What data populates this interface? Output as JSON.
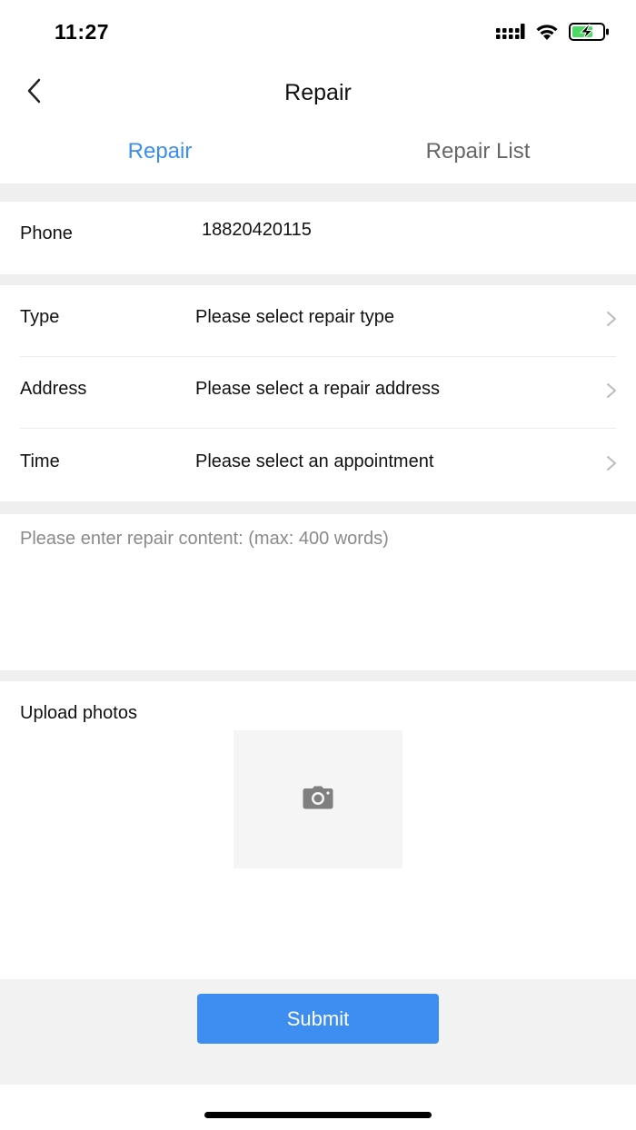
{
  "status_bar": {
    "time": "11:27"
  },
  "nav": {
    "title": "Repair"
  },
  "tabs": [
    {
      "label": "Repair",
      "active": true
    },
    {
      "label": "Repair List",
      "active": false
    }
  ],
  "form": {
    "phone": {
      "label": "Phone",
      "value": "18820420115"
    },
    "type": {
      "label": "Type",
      "placeholder": "Please select repair type"
    },
    "address": {
      "label": "Address",
      "placeholder": "Please select a repair address"
    },
    "time": {
      "label": "Time",
      "placeholder": "Please select an appointment"
    },
    "content": {
      "placeholder": "Please enter repair content: (max: 400 words)",
      "value": ""
    },
    "upload": {
      "label": "Upload photos"
    }
  },
  "submit": {
    "label": "Submit"
  },
  "colors": {
    "accent": "#3a8ef0",
    "button": "#3e8ef2",
    "divider_bg": "#efefef",
    "battery_charge": "#4cd964"
  },
  "icons": [
    "signal-icon",
    "wifi-icon",
    "battery-icon",
    "back-arrow-icon",
    "chevron-right-icon",
    "camera-icon"
  ]
}
